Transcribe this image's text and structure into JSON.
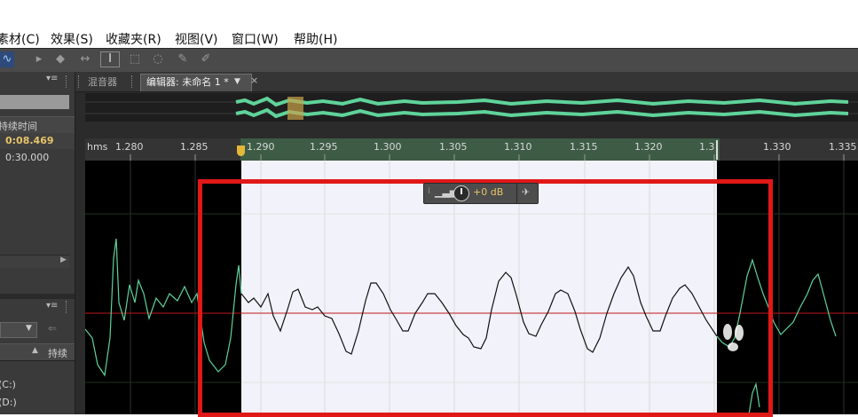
{
  "menu": {
    "items": [
      "素材(C)",
      "效果(S)",
      "收藏夹(R)",
      "视图(V)",
      "窗口(W)",
      "帮助(H)"
    ]
  },
  "left_panel": {
    "col_header": "持续时间",
    "rows": [
      "0:08.469",
      "0:30.000"
    ],
    "col_header2": "持续",
    "drive_c": "(C:)",
    "drive_d": "(D:)",
    "highlight_color": "#e8c46a"
  },
  "tabs": {
    "mixer": "混音器",
    "editor": "编辑器: 未命名 1 *"
  },
  "ruler": {
    "unit": "hms",
    "labels": [
      "1.280",
      "1.285",
      "1.290",
      "1.295",
      "1.300",
      "1.305",
      "1.310",
      "1.315",
      "1.320",
      "1.3",
      "1.330",
      "1.335"
    ]
  },
  "hud": {
    "volume": "+0 dB"
  },
  "colors": {
    "waveform": "#5fd39a",
    "selection_bg": "#f2f2fb",
    "centerline": "#c01818",
    "annotation_box": "#e01818"
  }
}
